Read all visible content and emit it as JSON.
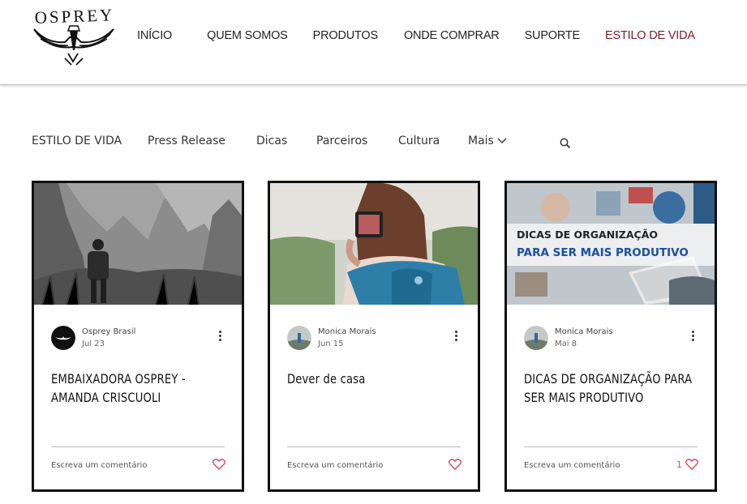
{
  "brand": {
    "logo_text": "OSPREY"
  },
  "nav": {
    "items": [
      {
        "label": "INÍCIO"
      },
      {
        "label": "QUEM SOMOS"
      },
      {
        "label": "PRODUTOS"
      },
      {
        "label": "ONDE COMPRAR"
      },
      {
        "label": "SUPORTE"
      },
      {
        "label": "ESTILO DE VIDA"
      }
    ],
    "active_color": "#7a1b28"
  },
  "categories": {
    "items": [
      {
        "label": "ESTILO DE VIDA"
      },
      {
        "label": "Press Release"
      },
      {
        "label": "Dicas"
      },
      {
        "label": "Parceiros"
      },
      {
        "label": "Cultura"
      }
    ],
    "more_label": "Mais"
  },
  "posts": [
    {
      "author": "Osprey Brasil",
      "date": "Jul 23",
      "title": "EMBAIXADORA OSPREY - AMANDA CRISCUOLI",
      "comment_label": "Escreva um comentário",
      "likes": ""
    },
    {
      "author": "Monica Morais",
      "date": "Jun 15",
      "title": "Dever de casa",
      "comment_label": "Escreva um comentário",
      "likes": ""
    },
    {
      "author": "Monica Morais",
      "date": "Mai 8",
      "title": "DICAS DE ORGANIZAÇÃO PARA SER MAIS PRODUTIVO",
      "comment_label": "Escreva um comentário",
      "likes": "1",
      "image_text": {
        "line1": "DICAS DE ORGANIZAÇÃO",
        "line2": "PARA SER MAIS PRODUTIVO"
      }
    }
  ],
  "colors": {
    "heart": "#d8475a",
    "card_border": "#111111"
  }
}
